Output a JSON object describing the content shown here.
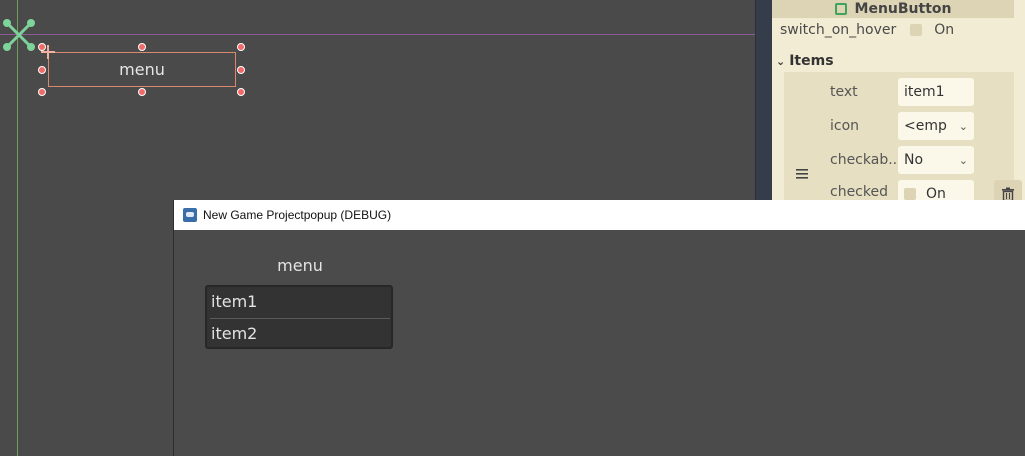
{
  "canvas": {
    "button_text": "menu"
  },
  "inspector": {
    "class_name": "MenuButton",
    "switch_on_hover": {
      "label": "switch_on_hover",
      "value": "On"
    },
    "items_section": "Items",
    "item": {
      "text_label": "text",
      "text_value": "item1",
      "icon_label": "icon",
      "icon_value": "<emp",
      "checkable_label": "checkab...",
      "checkable_value": "No",
      "checked_label": "checked",
      "checked_value": "On"
    }
  },
  "debug_window": {
    "title": "New Game Projectpopup (DEBUG)",
    "menu_label": "menu",
    "popup_items": [
      "item1",
      "item2"
    ]
  },
  "colors": {
    "editor_bg": "#4a4a4a",
    "inspector_bg": "#f2ecd4",
    "selection_outline": "#d88a70",
    "handle": "#f06a6a",
    "popup_bg": "#333333"
  }
}
